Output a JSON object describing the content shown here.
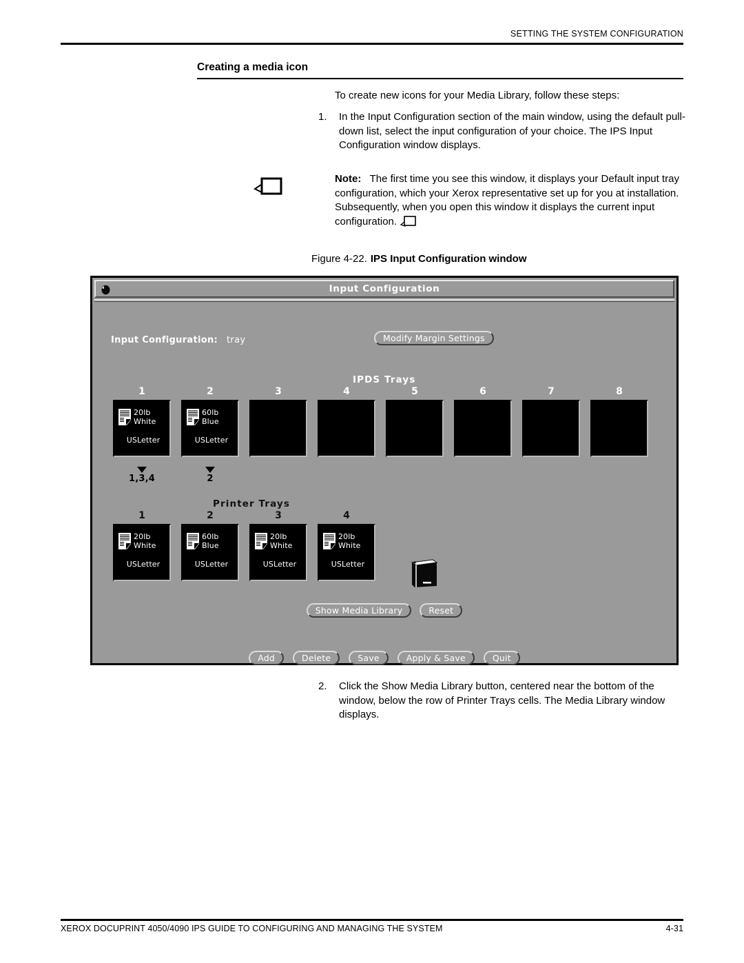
{
  "page": {
    "running_header": "SETTING THE SYSTEM CONFIGURATION",
    "footer_left": "XEROX DOCUPRINT 4050/4090 IPS GUIDE TO CONFIGURING AND MANAGING THE SYSTEM",
    "footer_page_number": "4-31"
  },
  "section": {
    "heading": "Creating a media icon",
    "intro": "To create new icons for your Media Library, follow these steps:"
  },
  "steps": [
    {
      "number": "1.",
      "text": "In the Input Configuration section of the main window, using the default pull-down list, select the input configuration of your choice. The IPS Input Configuration window displays."
    },
    {
      "number": "2.",
      "text": "Click the Show Media Library button, centered near the bottom of the window, below the row of Printer Trays cells. The Media Library window displays."
    }
  ],
  "note": {
    "label": "Note:",
    "text": "The first time you see this window, it displays your Default input tray configuration, which your Xerox representative set up for you at installation. Subsequently, when you open this window it displays the current input configuration."
  },
  "figure": {
    "number": "Figure 4-22.",
    "title": "IPS Input Configuration window"
  },
  "window": {
    "title": "Input Configuration",
    "config_label": "Input Configuration:",
    "config_value": "tray",
    "modify_margin_button": "Modify Margin Settings",
    "ipds_trays_heading": "IPDS Trays",
    "printer_trays_heading": "Printer Trays",
    "ipds_trays": [
      {
        "number": "1",
        "weight": "20lb",
        "color": "White",
        "size": "USLetter",
        "filled": true,
        "map": "1,3,4"
      },
      {
        "number": "2",
        "weight": "60lb",
        "color": "Blue",
        "size": "USLetter",
        "filled": true,
        "map": "2"
      },
      {
        "number": "3",
        "weight": "",
        "color": "",
        "size": "",
        "filled": false,
        "map": ""
      },
      {
        "number": "4",
        "weight": "",
        "color": "",
        "size": "",
        "filled": false,
        "map": ""
      },
      {
        "number": "5",
        "weight": "",
        "color": "",
        "size": "",
        "filled": false,
        "map": ""
      },
      {
        "number": "6",
        "weight": "",
        "color": "",
        "size": "",
        "filled": false,
        "map": ""
      },
      {
        "number": "7",
        "weight": "",
        "color": "",
        "size": "",
        "filled": false,
        "map": ""
      },
      {
        "number": "8",
        "weight": "",
        "color": "",
        "size": "",
        "filled": false,
        "map": ""
      }
    ],
    "printer_trays": [
      {
        "number": "1",
        "weight": "20lb",
        "color": "White",
        "size": "USLetter",
        "filled": true
      },
      {
        "number": "2",
        "weight": "60lb",
        "color": "Blue",
        "size": "USLetter",
        "filled": true
      },
      {
        "number": "3",
        "weight": "20lb",
        "color": "White",
        "size": "USLetter",
        "filled": true
      },
      {
        "number": "4",
        "weight": "20lb",
        "color": "White",
        "size": "USLetter",
        "filled": true
      }
    ],
    "mid_buttons": [
      {
        "label": "Show Media Library"
      },
      {
        "label": "Reset"
      }
    ],
    "bottom_buttons": [
      {
        "label": "Add"
      },
      {
        "label": "Delete"
      },
      {
        "label": "Save"
      },
      {
        "label": "Apply & Save"
      },
      {
        "label": "Quit"
      }
    ],
    "icons": {
      "window_menu": "window-menu-icon",
      "media_library_book": "book-icon",
      "media_paper": "paper-icon"
    },
    "colors": {
      "window_background": "#9a9a9a",
      "cell_background": "#000000",
      "title_text": "#ffffff",
      "border": "#000000"
    }
  }
}
